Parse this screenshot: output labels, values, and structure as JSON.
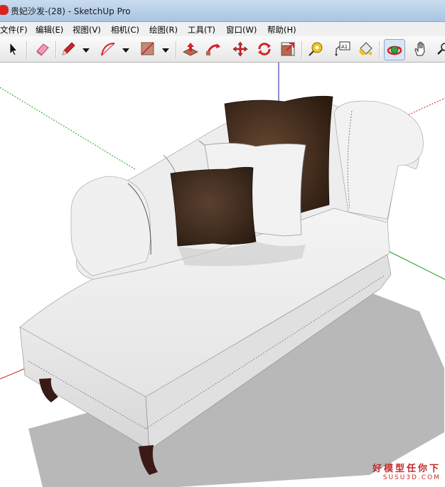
{
  "window": {
    "title": "贵妃沙发-(28) - SketchUp Pro"
  },
  "menu": {
    "file": "文件(F)",
    "edit": "编辑(E)",
    "view": "视图(V)",
    "camera": "相机(C)",
    "draw": "绘图(R)",
    "tools": "工具(T)",
    "window": "窗口(W)",
    "help": "帮助(H)"
  },
  "toolbar": {
    "icons": [
      "select-icon",
      "eraser-icon",
      "pencil-icon",
      "arc-icon",
      "rectangle-icon",
      "push-pull-icon",
      "follow-me-icon",
      "move-icon",
      "rotate-icon",
      "scale-icon",
      "tape-measure-icon",
      "text-icon",
      "paint-bucket-icon",
      "orbit-icon",
      "pan-icon",
      "zoom-icon"
    ],
    "text_tool_label": "A1"
  },
  "watermark": {
    "cn": "好模型任你下",
    "en": "SUSU3D.COM"
  },
  "colors": {
    "accent_red": "#c42a2a",
    "axis_green": "#1ea01e",
    "axis_blue": "#1a1aa0",
    "axis_red": "#d02020",
    "pillow_brown": "#4a3322",
    "fabric_white": "#eeeeee"
  }
}
